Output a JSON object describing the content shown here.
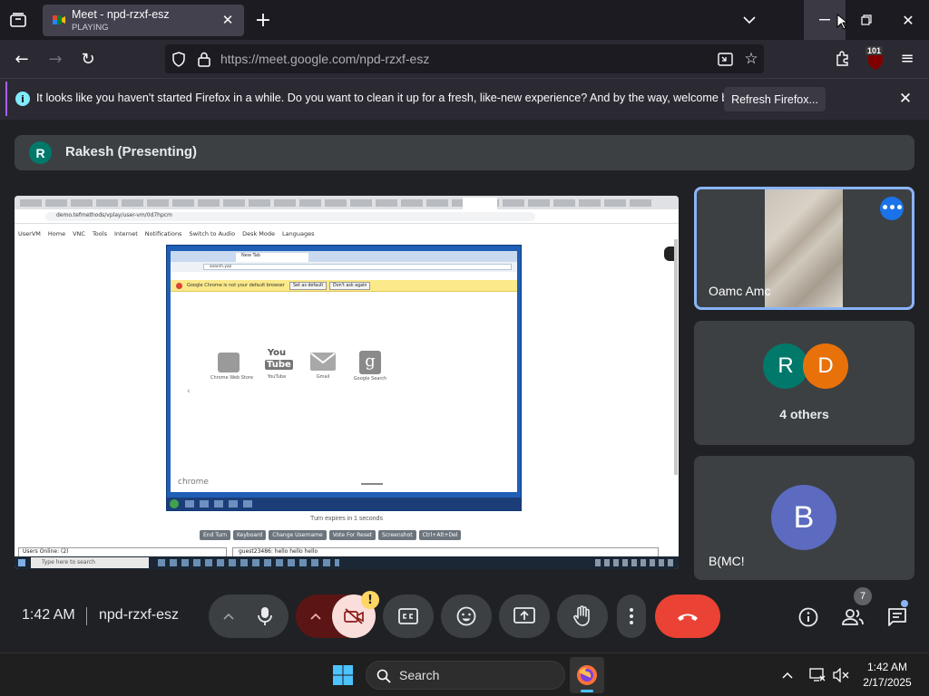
{
  "browser": {
    "tab": {
      "title": "Meet - npd-rzxf-esz",
      "status": "PLAYING"
    },
    "url": "https://meet.google.com/npd-rzxf-esz",
    "badge_count": "101",
    "notification": {
      "text": "It looks like you haven't started Firefox in a while. Do you want to clean it up for a fresh, like-new experience? And by the way, welcome back!",
      "button": "Refresh Firefox..."
    }
  },
  "meet": {
    "presenter": {
      "initial": "R",
      "name": "Rakesh (Presenting)"
    },
    "participants": [
      {
        "name": "Oamc Amc"
      },
      {
        "initials": [
          "R",
          "D"
        ],
        "label": "4 others"
      },
      {
        "initial": "B",
        "name": "B(MC!"
      }
    ],
    "bottom": {
      "time": "1:42 AM",
      "meeting_code": "npd-rzxf-esz",
      "people_count": "7"
    },
    "colors": {
      "accent": "#8ab4f8",
      "end_call": "#ea4335",
      "avatar_r": "#00796b",
      "avatar_d": "#e8710a",
      "avatar_b": "#5c6bc0"
    }
  },
  "shared_screen": {
    "toolbar_url": "demo.tefmethods/vplay/user-vm/0d7hpcm",
    "menu": [
      "UserVM",
      "Home",
      "VNC",
      "Tools",
      "Internet",
      "Notifications",
      "Switch to Audio",
      "Desk Mode",
      "Languages"
    ],
    "inner_browser": {
      "tab": "New Tab",
      "address": "search.yaz",
      "infobar": "Google Chrome is not your default browser",
      "infobar_buttons": [
        "Set as default",
        "Don't ask again"
      ],
      "apps": [
        {
          "name": "Chrome Web Store",
          "icon": "store-icon"
        },
        {
          "name": "YouTube",
          "icon": "youtube-icon"
        },
        {
          "name": "Gmail",
          "icon": "gmail-icon"
        },
        {
          "name": "Google Search",
          "icon": "google-icon"
        }
      ],
      "footer_brand": "chrome"
    },
    "turn_text": "Turn expires in 1 seconds",
    "action_buttons": [
      "End Turn",
      "Keyboard",
      "Change Username",
      "Vote For Reset",
      "Screenshot",
      "Ctrl+Alt+Del"
    ],
    "users_online": "Users Online: (2)",
    "chat_line": "guest23486: hello hello hello",
    "taskbar_search": "Type here to search"
  },
  "taskbar": {
    "search": "Search",
    "time": "1:42 AM",
    "date": "2/17/2025"
  }
}
